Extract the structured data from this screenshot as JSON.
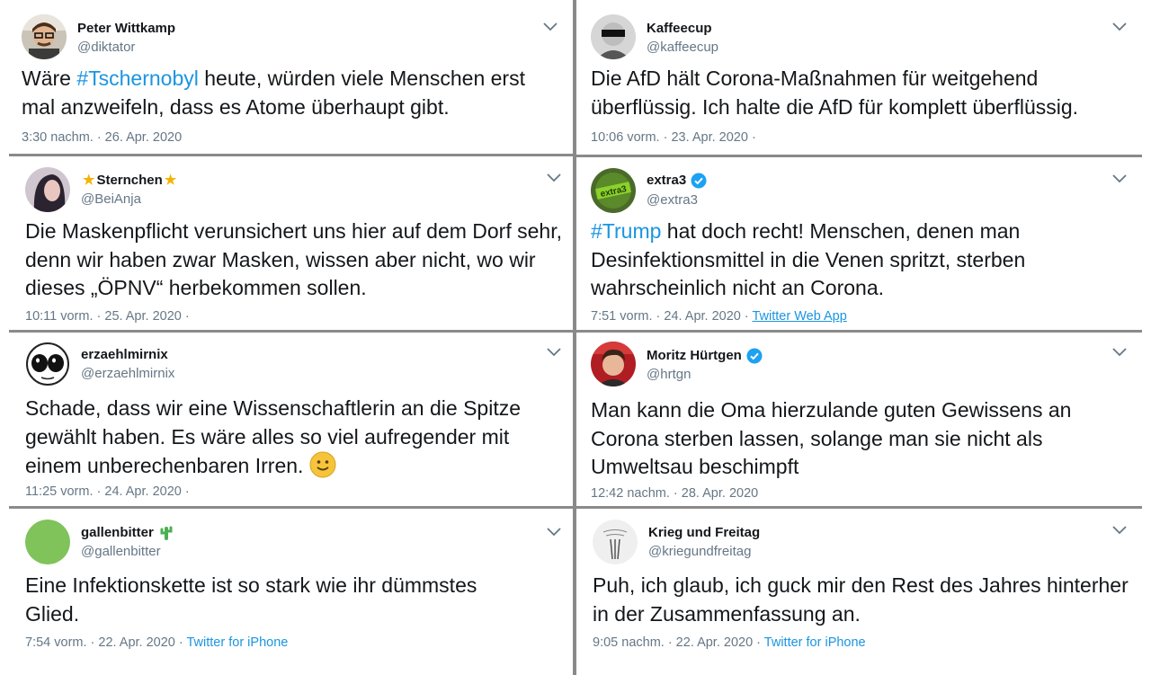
{
  "tweets": [
    {
      "name": "Peter Wittkamp",
      "handle": "@diktator",
      "pre": "Wäre ",
      "hashtag": "#Tschernobyl",
      "post": " heute, würden viele Menschen erst mal anzweifeln, dass es Atome überhaupt gibt.",
      "time": "3:30 nachm. · 26. Apr. 2020",
      "source": ""
    },
    {
      "name": "Kaffeecup",
      "handle": "@kaffeecup",
      "pre": "Die AfD hält Corona-Maßnahmen für weitgehend überflüssig. Ich halte die AfD für komplett überflüssig.",
      "hashtag": "",
      "post": "",
      "time": "10:06 vorm. · 23. Apr. 2020 ·",
      "source": ""
    },
    {
      "name": "Sternchen",
      "handle": "@BeiAnja",
      "pre": "Die Maskenpflicht verunsichert uns hier auf dem Dorf sehr, denn wir haben zwar Masken, wissen aber nicht, wo wir dieses „ÖPNV“ herbekommen sollen.",
      "hashtag": "",
      "post": "",
      "time": "10:11 vorm. · 25. Apr. 2020 ·",
      "source": ""
    },
    {
      "name": "extra3",
      "handle": "@extra3",
      "pre": "",
      "hashtag": "#Trump",
      "post": " hat doch recht! Menschen, denen man Desinfektionsmittel in die Venen spritzt, sterben wahrscheinlich nicht an Corona.",
      "time": "7:51 vorm. · 24. Apr. 2020 ·",
      "source": "Twitter Web App"
    },
    {
      "name": "erzaehlmirnix",
      "handle": "@erzaehlmirnix",
      "pre": "Schade, dass wir eine Wissenschaftlerin an die Spitze gewählt haben. Es wäre alles so viel aufregender mit einem unberechenbaren Irren.",
      "hashtag": "",
      "post": "",
      "time": "11:25 vorm. · 24. Apr. 2020 ·",
      "source": ""
    },
    {
      "name": "Moritz Hürtgen",
      "handle": "@hrtgn",
      "pre": "Man kann die Oma hierzulande guten Gewissens an Corona sterben lassen, solange man sie nicht als Umweltsau beschimpft",
      "hashtag": "",
      "post": "",
      "time": "12:42 nachm. · 28. Apr. 2020",
      "source": ""
    },
    {
      "name": "gallenbitter",
      "handle": "@gallenbitter",
      "pre": "Eine Infektionskette ist so stark wie ihr dümmstes Glied.",
      "hashtag": "",
      "post": "",
      "time": "7:54 vorm. · 22. Apr. 2020 ·",
      "source": "Twitter for iPhone"
    },
    {
      "name": "Krieg und Freitag",
      "handle": "@kriegundfreitag",
      "pre": "Puh, ich glaub, ich guck mir den Rest des Jahres hinterher in der Zusammenfassung an.",
      "hashtag": "",
      "post": "",
      "time": "9:05 nachm. · 22. Apr. 2020 ·",
      "source": "Twitter for iPhone"
    }
  ],
  "colors": {
    "text": "#14171a",
    "secondary": "#657786",
    "link": "#1b95e0",
    "verified": "#1da1f2",
    "separator": "#8a8a8a"
  }
}
